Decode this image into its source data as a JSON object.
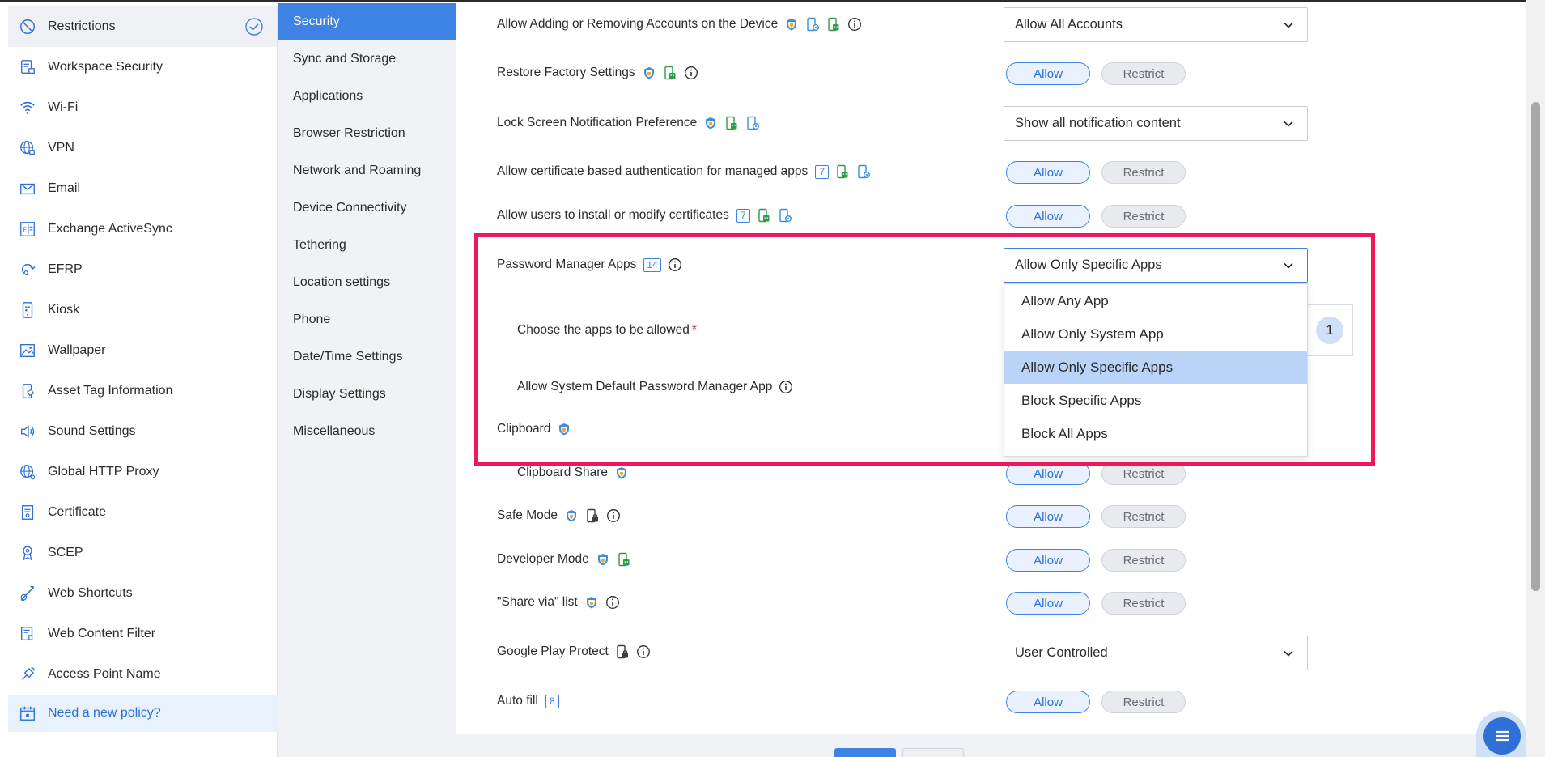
{
  "sidebar": {
    "items": [
      {
        "label": "Restrictions",
        "icon": "prohibited-icon"
      },
      {
        "label": "Workspace Security",
        "icon": "workspace-lock-icon"
      },
      {
        "label": "Wi-Fi",
        "icon": "wifi-icon"
      },
      {
        "label": "VPN",
        "icon": "globe-lock-icon"
      },
      {
        "label": "Email",
        "icon": "envelope-icon"
      },
      {
        "label": "Exchange ActiveSync",
        "icon": "exchange-icon"
      },
      {
        "label": "EFRP",
        "icon": "refresh-key-icon"
      },
      {
        "label": "Kiosk",
        "icon": "kiosk-phone-icon"
      },
      {
        "label": "Wallpaper",
        "icon": "picture-icon"
      },
      {
        "label": "Asset Tag Information",
        "icon": "asset-tag-icon"
      },
      {
        "label": "Sound Settings",
        "icon": "speaker-icon"
      },
      {
        "label": "Global HTTP Proxy",
        "icon": "globe-network-icon"
      },
      {
        "label": "Certificate",
        "icon": "certificate-icon"
      },
      {
        "label": "SCEP",
        "icon": "scep-badge-icon"
      },
      {
        "label": "Web Shortcuts",
        "icon": "link-icon"
      },
      {
        "label": "Web Content Filter",
        "icon": "filter-list-icon"
      },
      {
        "label": "Access Point Name",
        "icon": "access-point-icon"
      }
    ],
    "new_policy": "Need a new policy?"
  },
  "subnav": {
    "items": [
      "Security",
      "Sync and Storage",
      "Applications",
      "Browser Restriction",
      "Network and Roaming",
      "Device Connectivity",
      "Tethering",
      "Location settings",
      "Phone",
      "Date/Time Settings",
      "Display Settings",
      "Miscellaneous"
    ]
  },
  "settings": {
    "add_remove_accounts": {
      "label": "Allow Adding or Removing Accounts on the Device",
      "value": "Allow All Accounts"
    },
    "factory_reset": {
      "label": "Restore Factory Settings"
    },
    "lock_screen": {
      "label": "Lock Screen Notification Preference",
      "value": "Show all notification content"
    },
    "cert_auth": {
      "label": "Allow certificate based authentication for managed apps",
      "badge": "7"
    },
    "install_certs": {
      "label": "Allow users to install or modify certificates",
      "badge": "7"
    },
    "password_manager": {
      "label": "Password Manager Apps",
      "badge": "14",
      "value": "Allow Only Specific Apps"
    },
    "choose_apps": {
      "label": "Choose the apps to be allowed",
      "required": "*",
      "count": "1"
    },
    "system_pm": {
      "label": "Allow System Default Password Manager App"
    },
    "clipboard": {
      "label": "Clipboard"
    },
    "clipboard_share": {
      "label": "Clipboard Share"
    },
    "safe_mode": {
      "label": "Safe Mode"
    },
    "developer_mode": {
      "label": "Developer Mode"
    },
    "share_via": {
      "label": "\"Share via\" list"
    },
    "play_protect": {
      "label": "Google Play Protect",
      "value": "User Controlled"
    },
    "auto_fill": {
      "label": "Auto fill",
      "badge": "8"
    }
  },
  "buttons": {
    "allow": "Allow",
    "restrict": "Restrict"
  },
  "dropdown": {
    "options": [
      "Allow Any App",
      "Allow Only System App",
      "Allow Only Specific Apps",
      "Block Specific Apps",
      "Block All Apps"
    ],
    "selected_index": 2
  },
  "colors": {
    "accent": "#3e82e4",
    "highlight": "#f0175a",
    "android_green": "#2e9b4a",
    "shield_blue": "#3a8fd8"
  }
}
